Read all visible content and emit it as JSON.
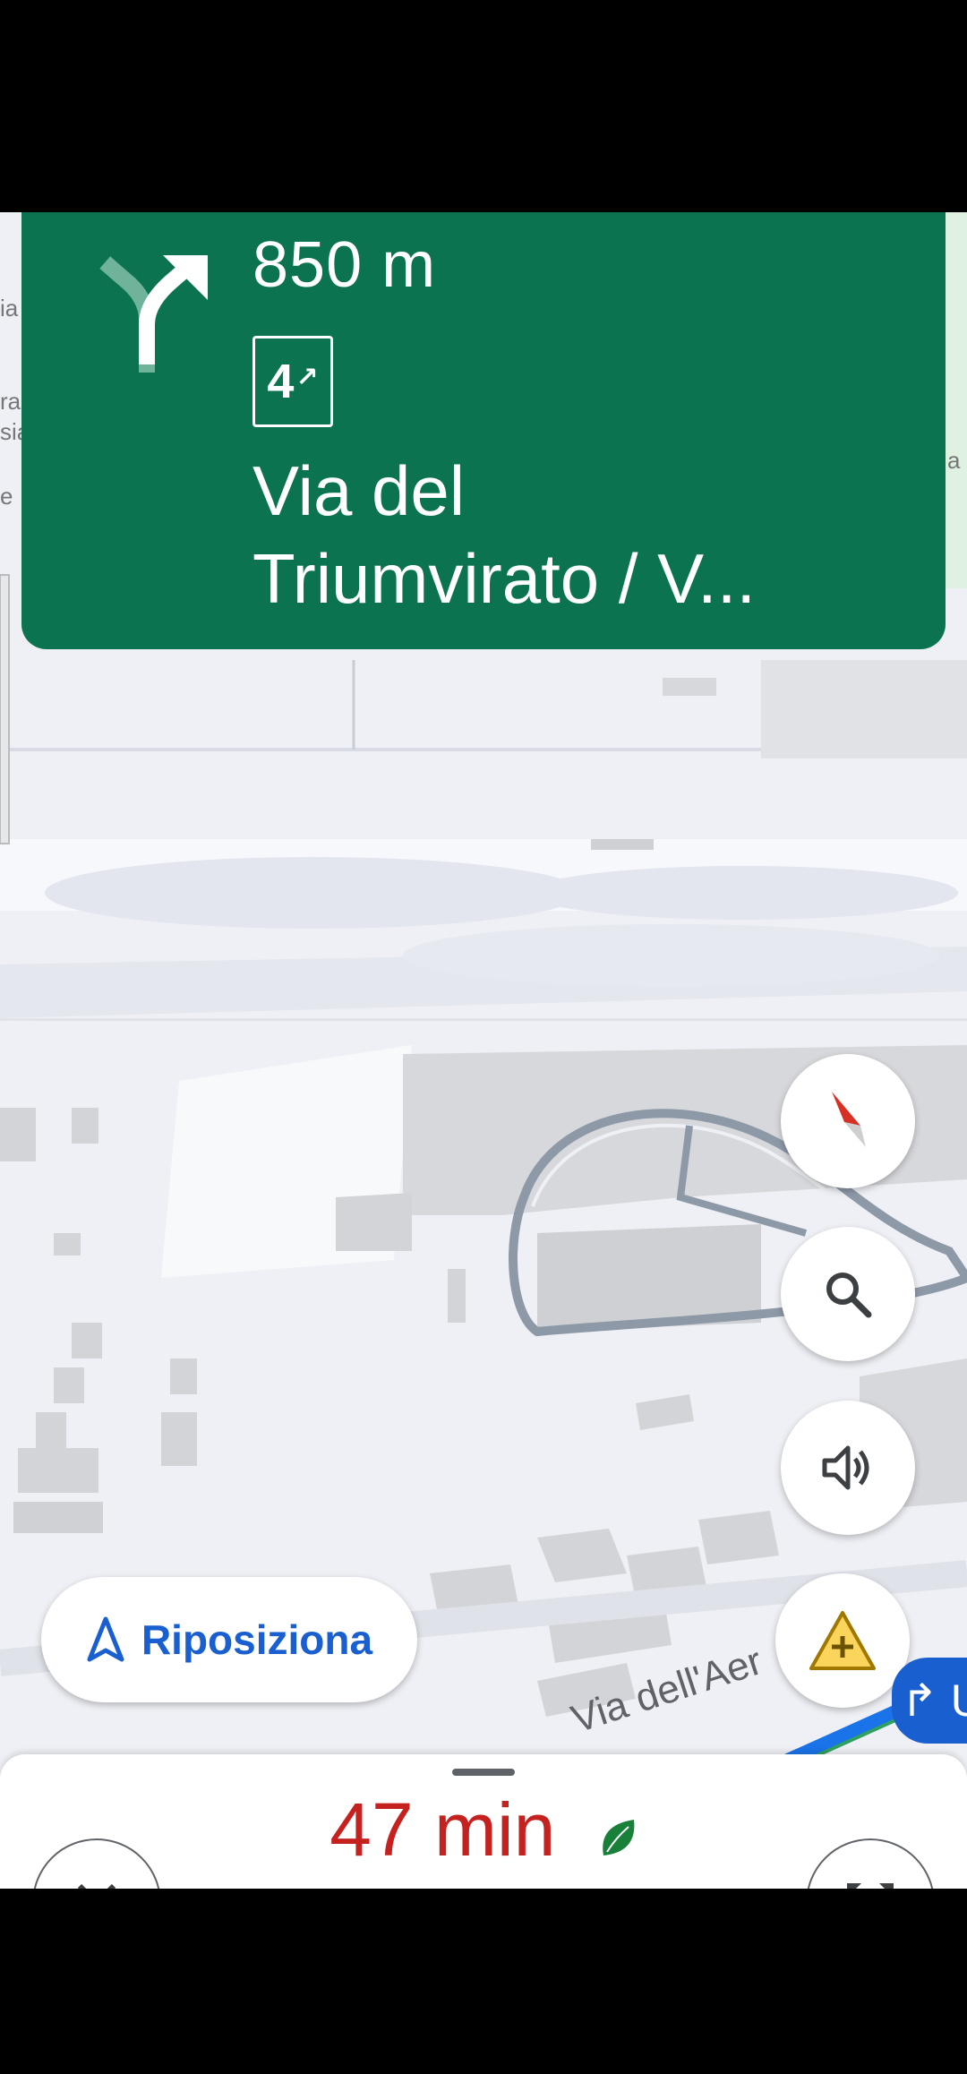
{
  "navigation": {
    "distance": "850 m",
    "exit_number": "4",
    "exit_arrow": "↗",
    "street_line1": "Via del",
    "street_line2": "Triumvirato / V..."
  },
  "map": {
    "road_label": "Via dell'Aer",
    "lane_badge": "↱ U",
    "edge_fragments": [
      "ia",
      "ra",
      "sia",
      "e",
      "a"
    ]
  },
  "buttons": {
    "recenter_label": "Riposiziona"
  },
  "trip": {
    "eta": "47 min"
  },
  "colors": {
    "nav_green": "#0b7350",
    "eta_red": "#c5221f",
    "recenter_blue": "#1a5fd0",
    "eco_leaf": "#188038",
    "hazard_yellow": "#f2b600"
  },
  "icons": [
    "turn-right-icon",
    "compass-icon",
    "search-icon",
    "volume-icon",
    "report-hazard-icon",
    "navigation-arrow-icon",
    "close-icon",
    "alternate-routes-icon",
    "leaf-icon"
  ]
}
